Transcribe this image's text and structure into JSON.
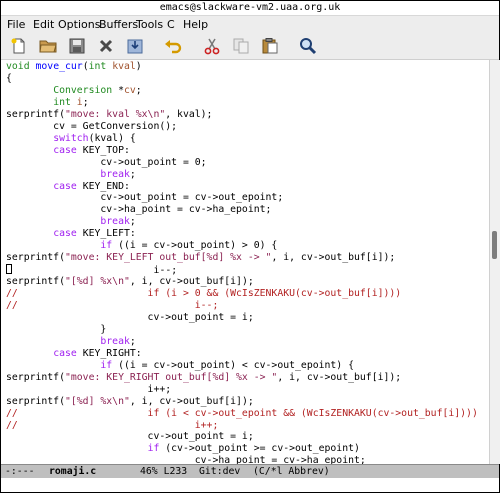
{
  "window": {
    "title": "emacs@slackware-vm2.uaa.org.uk"
  },
  "menu": [
    "File",
    "Edit",
    "Options",
    "Buffers",
    "Tools",
    "C",
    "Help"
  ],
  "toolbar": [
    "new-file-icon",
    "open-folder-icon",
    "save-icon",
    "close-icon",
    "save-as-icon",
    "undo-icon",
    "cut-icon",
    "copy-icon",
    "paste-icon",
    "search-icon"
  ],
  "code_lines": [
    [
      {
        "t": "void ",
        "c": "ty"
      },
      {
        "t": "move_cur",
        "c": "fn"
      },
      {
        "t": "("
      },
      {
        "t": "int ",
        "c": "ty"
      },
      {
        "t": "kval",
        "c": "va"
      },
      {
        "t": ")"
      }
    ],
    [
      {
        "t": "{"
      }
    ],
    [
      {
        "t": "        "
      },
      {
        "t": "Conversion ",
        "c": "ty"
      },
      {
        "t": "*"
      },
      {
        "t": "cv",
        "c": "va"
      },
      {
        "t": ";"
      }
    ],
    [
      {
        "t": "        "
      },
      {
        "t": "int ",
        "c": "ty"
      },
      {
        "t": "i",
        "c": "va"
      },
      {
        "t": ";"
      }
    ],
    [
      {
        "t": "serprintf("
      },
      {
        "t": "\"move: kval %x\\n\"",
        "c": "st"
      },
      {
        "t": ", kval);"
      }
    ],
    [
      {
        "t": "        cv = GetConversion();"
      }
    ],
    [
      {
        "t": "        "
      },
      {
        "t": "switch",
        "c": "kw"
      },
      {
        "t": "(kval) {"
      }
    ],
    [
      {
        "t": "        "
      },
      {
        "t": "case ",
        "c": "kw"
      },
      {
        "t": "KEY_TOP:"
      }
    ],
    [
      {
        "t": "                cv->out_point = 0;"
      }
    ],
    [
      {
        "t": "                "
      },
      {
        "t": "break",
        "c": "kw"
      },
      {
        "t": ";"
      }
    ],
    [
      {
        "t": "        "
      },
      {
        "t": "case ",
        "c": "kw"
      },
      {
        "t": "KEY_END:"
      }
    ],
    [
      {
        "t": "                cv->out_point = cv->out_epoint;"
      }
    ],
    [
      {
        "t": "                cv->ha_point = cv->ha_epoint;"
      }
    ],
    [
      {
        "t": "                "
      },
      {
        "t": "break",
        "c": "kw"
      },
      {
        "t": ";"
      }
    ],
    [
      {
        "t": "        "
      },
      {
        "t": "case ",
        "c": "kw"
      },
      {
        "t": "KEY_LEFT:"
      }
    ],
    [
      {
        "t": "                "
      },
      {
        "t": "if",
        "c": "kw"
      },
      {
        "t": " ((i = cv->out_point) > 0) {"
      }
    ],
    [
      {
        "t": "serprintf("
      },
      {
        "t": "\"move: KEY_LEFT out_buf[%d] %x -> \"",
        "c": "st"
      },
      {
        "t": ", i, cv->out_buf[i]);"
      }
    ],
    [
      {
        "t": "",
        "cursor": true
      },
      {
        "t": "                        i--;"
      }
    ],
    [
      {
        "t": "serprintf("
      },
      {
        "t": "\"[%d] %x\\n\"",
        "c": "st"
      },
      {
        "t": ", i, cv->out_buf[i]);"
      }
    ],
    [
      {
        "t": "//                      if (i > 0 && (WcIsZENKAKU(cv->out_buf[i])))",
        "c": "cm"
      }
    ],
    [
      {
        "t": "//                              i--;",
        "c": "cm"
      }
    ],
    [
      {
        "t": "                        cv->out_point = i;"
      }
    ],
    [
      {
        "t": "                }"
      }
    ],
    [
      {
        "t": "                "
      },
      {
        "t": "break",
        "c": "kw"
      },
      {
        "t": ";"
      }
    ],
    [
      {
        "t": "        "
      },
      {
        "t": "case ",
        "c": "kw"
      },
      {
        "t": "KEY_RIGHT:"
      }
    ],
    [
      {
        "t": "                "
      },
      {
        "t": "if",
        "c": "kw"
      },
      {
        "t": " ((i = cv->out_point) < cv->out_epoint) {"
      }
    ],
    [
      {
        "t": "serprintf("
      },
      {
        "t": "\"move: KEY_RIGHT out_buf[%d] %x -> \"",
        "c": "st"
      },
      {
        "t": ", i, cv->out_buf[i]);"
      }
    ],
    [
      {
        "t": "                        i++;"
      }
    ],
    [
      {
        "t": "serprintf("
      },
      {
        "t": "\"[%d] %x\\n\"",
        "c": "st"
      },
      {
        "t": ", i, cv->out_buf[i]);"
      }
    ],
    [
      {
        "t": "//                      if (i < cv->out_epoint && (WcIsZENKAKU(cv->out_buf[i])))",
        "c": "cm"
      }
    ],
    [
      {
        "t": "//                              i++;",
        "c": "cm"
      }
    ],
    [
      {
        "t": "                        cv->out_point = i;"
      }
    ],
    [
      {
        "t": "                        "
      },
      {
        "t": "if",
        "c": "kw"
      },
      {
        "t": " (cv->out_point >= cv->out_epoint)"
      }
    ],
    [
      {
        "t": "                                cv->ha_point = cv->ha_epoint;"
      }
    ]
  ],
  "modeline": {
    "status": "-:---",
    "buffer": "romaji.c",
    "position": "46% L233",
    "vc": "Git:dev",
    "modes": "(C/*l Abbrev)"
  },
  "minibuffer": ""
}
